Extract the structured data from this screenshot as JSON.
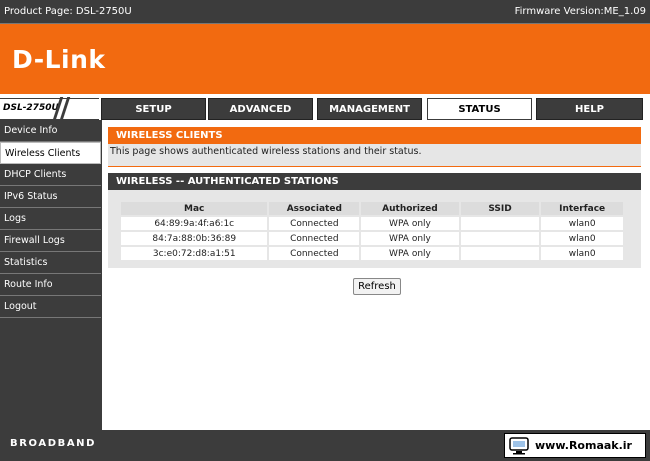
{
  "header": {
    "product_page": "Product Page: DSL-2750U",
    "firmware": "Firmware Version:ME_1.09"
  },
  "brand": {
    "logo": "D-Link"
  },
  "model": "DSL-2750U",
  "tabs": [
    {
      "label": "SETUP"
    },
    {
      "label": "ADVANCED"
    },
    {
      "label": "MANAGEMENT"
    },
    {
      "label": "STATUS"
    },
    {
      "label": "HELP"
    }
  ],
  "sidebar": {
    "items": [
      {
        "label": "Device Info"
      },
      {
        "label": "Wireless Clients"
      },
      {
        "label": "DHCP Clients"
      },
      {
        "label": "IPv6 Status"
      },
      {
        "label": "Logs"
      },
      {
        "label": "Firewall Logs"
      },
      {
        "label": "Statistics"
      },
      {
        "label": "Route Info"
      },
      {
        "label": "Logout"
      }
    ]
  },
  "main": {
    "panel_title": "WIRELESS CLIENTS",
    "panel_desc": "This page shows authenticated wireless stations and their status.",
    "table_title": "WIRELESS -- AUTHENTICATED STATIONS",
    "columns": [
      "Mac",
      "Associated",
      "Authorized",
      "SSID",
      "Interface"
    ],
    "rows": [
      [
        "64:89:9a:4f:a6:1c",
        "Connected",
        "WPA only",
        "",
        "wlan0"
      ],
      [
        "84:7a:88:0b:36:89",
        "Connected",
        "WPA only",
        "",
        "wlan0"
      ],
      [
        "3c:e0:72:d8:a1:51",
        "Connected",
        "WPA only",
        "",
        "wlan0"
      ]
    ],
    "refresh_label": "Refresh"
  },
  "footer": {
    "label": "BROADBAND",
    "watermark": "www.Romaak.ir"
  },
  "colors": {
    "accent": "#f26a10",
    "dark": "#3c3c3c",
    "panel": "#e6e6e6"
  }
}
